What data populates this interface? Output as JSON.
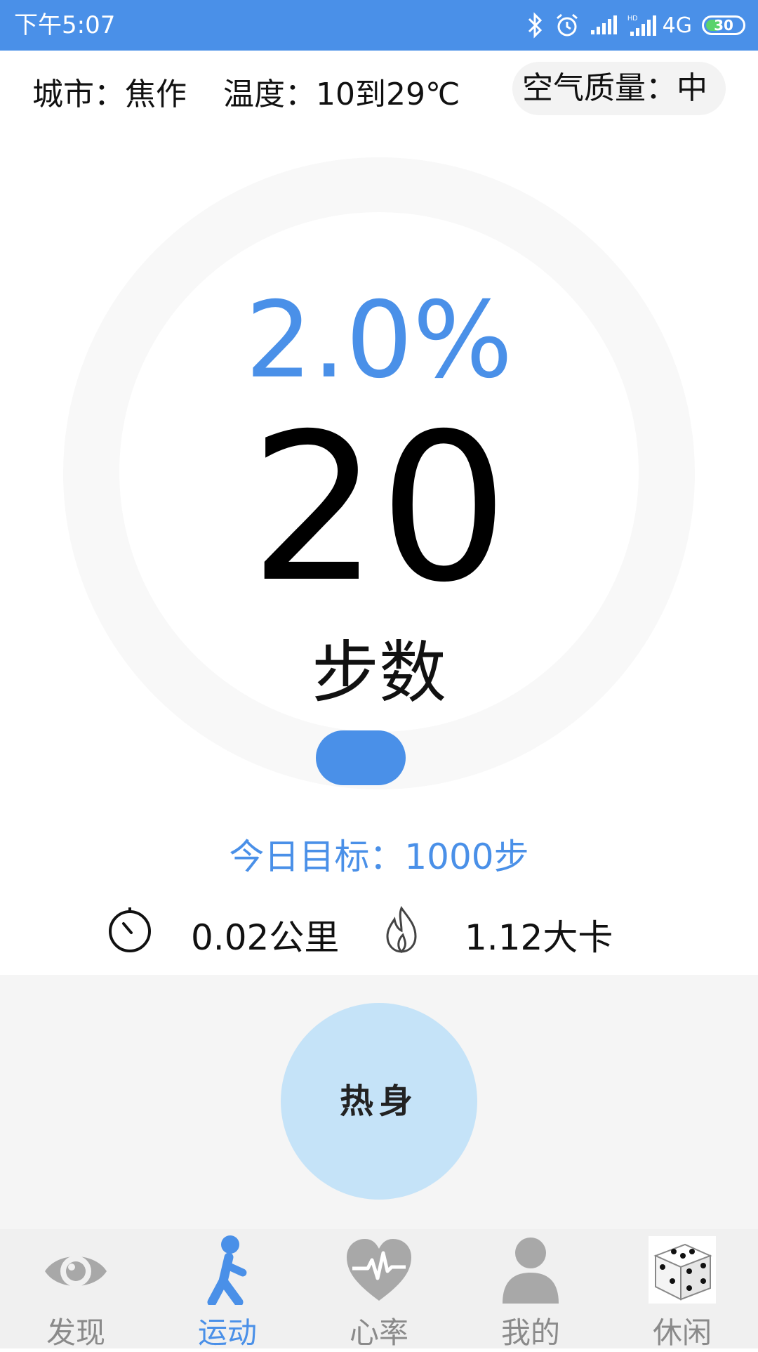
{
  "status_bar": {
    "time": "下午5:07",
    "network": "4G",
    "battery": "30",
    "icons": [
      "bluetooth-icon",
      "alarm-icon",
      "signal-icon",
      "hd-signal-icon"
    ]
  },
  "info": {
    "city": "城市：焦作",
    "temperature": "温度：10到29℃",
    "air_quality": "空气质量：中"
  },
  "progress": {
    "percent": "2.0%",
    "steps": "20",
    "steps_label": "步数",
    "goal": "今日目标：1000步"
  },
  "stats": {
    "distance": "0.02公里",
    "calories": "1.12大卡",
    "distance_icon": "stopwatch-icon",
    "calories_icon": "flame-icon"
  },
  "warmup": {
    "label": "热身"
  },
  "bottom_nav": {
    "items": [
      {
        "label": "发现",
        "icon": "eye-icon",
        "active": false
      },
      {
        "label": "运动",
        "icon": "running-icon",
        "active": true
      },
      {
        "label": "心率",
        "icon": "heart-rate-icon",
        "active": false
      },
      {
        "label": "我的",
        "icon": "person-icon",
        "active": false
      },
      {
        "label": "休闲",
        "icon": "dice-icon",
        "active": false
      }
    ]
  },
  "colors": {
    "accent": "#4a90e8",
    "warmup_button": "#c5e3f8",
    "ring_track": "#f8f8f8"
  }
}
